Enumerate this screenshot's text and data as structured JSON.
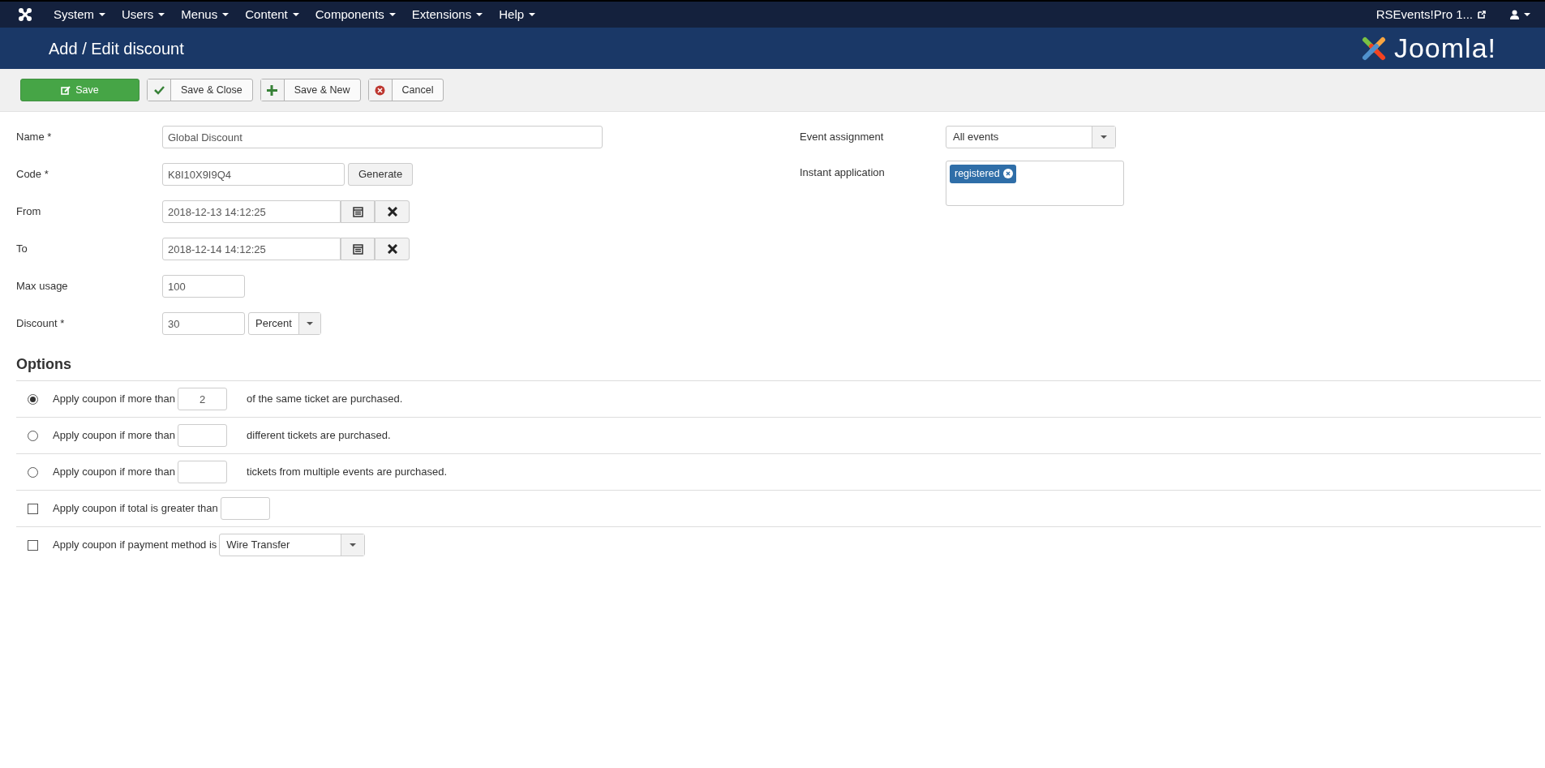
{
  "menu": {
    "items": [
      "System",
      "Users",
      "Menus",
      "Content",
      "Components",
      "Extensions",
      "Help"
    ],
    "site_link": "RSEvents!Pro 1..."
  },
  "header": {
    "title": "Add / Edit discount",
    "logo_text": "Joomla!"
  },
  "toolbar": [
    {
      "kind": "save",
      "label": "Save"
    },
    {
      "kind": "check",
      "label": "Save & Close"
    },
    {
      "kind": "plus",
      "label": "Save & New"
    },
    {
      "kind": "cancel",
      "label": "Cancel"
    }
  ],
  "left_fields": [
    {
      "kind": "text",
      "label": "Name *",
      "value": "Global Discount"
    },
    {
      "kind": "generate",
      "label": "Code *",
      "value": "K8I10X9I9Q4",
      "button": "Generate"
    },
    {
      "kind": "date",
      "label": "From",
      "value": "2018-12-13 14:12:25"
    },
    {
      "kind": "date",
      "label": "To",
      "value": "2018-12-14 14:12:25"
    },
    {
      "kind": "short",
      "label": "Max usage",
      "value": "100"
    },
    {
      "kind": "amount",
      "label": "Discount *",
      "value": "30",
      "unit": "Percent"
    }
  ],
  "right_fields": [
    {
      "kind": "select",
      "label": "Event assignment",
      "value": "All events"
    },
    {
      "kind": "tags",
      "label": "Instant application",
      "tags": [
        "registered"
      ]
    }
  ],
  "options": {
    "title": "Options",
    "rows": [
      {
        "kind": "radio",
        "checked": true,
        "prefix": "Apply coupon if more than",
        "value": "2",
        "suffix": "of the same ticket are purchased."
      },
      {
        "kind": "radio",
        "checked": false,
        "prefix": "Apply coupon if more than",
        "suffix": "different tickets are purchased."
      },
      {
        "kind": "radio",
        "checked": false,
        "prefix": "Apply coupon if more than",
        "suffix": "tickets from multiple events are purchased."
      },
      {
        "kind": "checkbox",
        "checked": false,
        "prefix": "Apply coupon if total is greater than"
      },
      {
        "kind": "checkbox_select",
        "checked": false,
        "prefix": "Apply coupon if payment method is",
        "select": "Wire Transfer"
      }
    ]
  }
}
